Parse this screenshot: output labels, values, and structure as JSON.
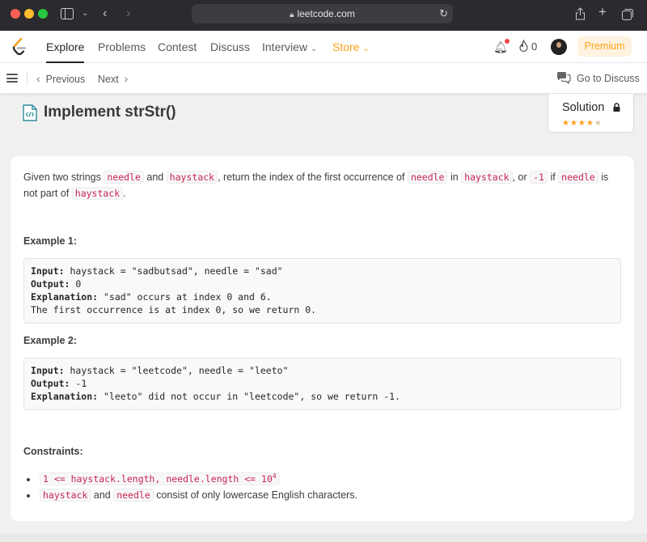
{
  "browser": {
    "url": "leetcode.com"
  },
  "nav": {
    "items": [
      "Explore",
      "Problems",
      "Contest",
      "Discuss",
      "Interview",
      "Store"
    ],
    "active": "Explore",
    "fire_count": "0",
    "premium_label": "Premium"
  },
  "subnav": {
    "previous_label": "Previous",
    "next_label": "Next",
    "discuss_label": "Go to Discuss"
  },
  "problem": {
    "title": "Implement strStr()",
    "solution_label": "Solution",
    "rating": "4.5",
    "description": {
      "t1": "Given two strings ",
      "c1": "needle",
      "t2": " and ",
      "c2": "haystack",
      "t3": ", return the index of the first occurrence of ",
      "c3": "needle",
      "t4": " in ",
      "c4": "haystack",
      "t5": ", or ",
      "c5": "-1",
      "t6": " if ",
      "c6": "needle",
      "t7": " is not part of ",
      "c7": "haystack",
      "t8": "."
    },
    "examples": [
      {
        "heading": "Example 1:",
        "input_label": "Input:",
        "input": " haystack = \"sadbutsad\", needle = \"sad\"",
        "output_label": "Output:",
        "output": " 0",
        "explanation_label": "Explanation:",
        "explanation": " \"sad\" occurs at index 0 and 6.",
        "extra": "The first occurrence is at index 0, so we return 0."
      },
      {
        "heading": "Example 2:",
        "input_label": "Input:",
        "input": " haystack = \"leetcode\", needle = \"leeto\"",
        "output_label": "Output:",
        "output": " -1",
        "explanation_label": "Explanation:",
        "explanation": " \"leeto\" did not occur in \"leetcode\", so we return -1."
      }
    ],
    "constraints_heading": "Constraints:",
    "constraints": {
      "c1_code": "1 <= haystack.length, needle.length <= 10",
      "c1_sup": "4",
      "c2_code1": "haystack",
      "c2_t1": " and ",
      "c2_code2": "needle",
      "c2_t2": " consist of only lowercase English characters."
    }
  },
  "colors": {
    "accent": "#ffa116",
    "code_text": "#c7254e",
    "rating_star": "#ffa116"
  }
}
